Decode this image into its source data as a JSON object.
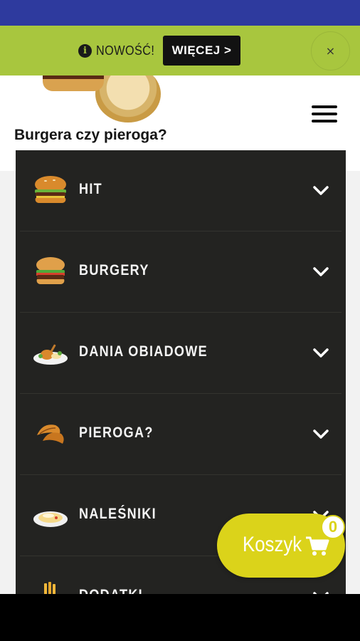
{
  "banner": {
    "text": "NOWOŚĆ!",
    "more_label": "WIĘCEJ >",
    "close_label": "×"
  },
  "header": {
    "tagline": "Burgera czy pieroga?"
  },
  "menu": {
    "items": [
      {
        "label": "HIT",
        "icon": "burger-icon"
      },
      {
        "label": "BURGERY",
        "icon": "burger-icon"
      },
      {
        "label": "DANIA OBIADOWE",
        "icon": "dinner-plate-icon"
      },
      {
        "label": "PIEROGA?",
        "icon": "pierogi-icon"
      },
      {
        "label": "NALEŚNIKI",
        "icon": "pancake-plate-icon"
      },
      {
        "label": "DODATKI",
        "icon": "fries-icon"
      }
    ]
  },
  "cart": {
    "label": "Koszyk",
    "count": "0"
  },
  "colors": {
    "status_bar": "#2e3a9e",
    "banner": "#a8c63e",
    "menu_bg": "#232321",
    "cart_accent": "#dbd31a"
  }
}
